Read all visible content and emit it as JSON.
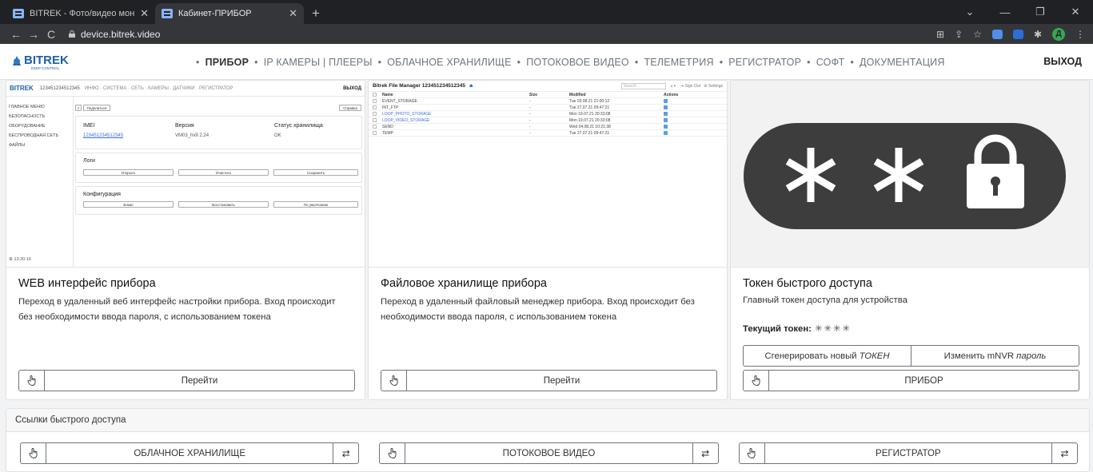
{
  "browser": {
    "tabs": [
      {
        "title": "BITREK - Фото/видео монитори"
      },
      {
        "title": "Кабинет-ПРИБОР"
      }
    ],
    "url": "device.bitrek.video",
    "profile_initial": "Д"
  },
  "header": {
    "logo_text": "BITREK",
    "logo_tagline": "KEEP CONTROL",
    "nav": [
      "ПРИБОР",
      "IP КАМЕРЫ | ПЛЕЕРЫ",
      "ОБЛАЧНОЕ ХРАНИЛИЩЕ",
      "ПОТОКОВОЕ ВИДЕО",
      "ТЕЛЕМЕТРИЯ",
      "РЕГИСТРАТОР",
      "СОФТ",
      "ДОКУМЕНТАЦИЯ"
    ],
    "exit": "ВЫХОД"
  },
  "cards": [
    {
      "title": "WEB интерфейс прибора",
      "text": "Переход в удаленный веб интерфейс настройки прибора. Вход происходит без необходимости ввода пароля, с использованием токена",
      "button": "Перейти"
    },
    {
      "title": "Файловое хранилище прибора",
      "text": "Переход в удаленный файловый менеджер прибора. Вход происходит без необходимости ввода пароля, с использованием токена",
      "button": "Перейти"
    },
    {
      "title": "Токен быстрого доступа",
      "text": "Главный токен доступа для устройства",
      "token_label": "Текущий токен:",
      "token_value": "✳✳✳✳",
      "generate": "Сгенерировать новый",
      "generate_em": "ТОКЕН",
      "change": "Изменить mNVR",
      "change_em": "пароль",
      "button": "ПРИБОР"
    }
  ],
  "quick": {
    "header": "Ссылки быстрого доступа",
    "links": [
      "ОБЛАЧНОЕ ХРАНИЛИЩЕ",
      "ПОТОКОВОЕ ВИДЕО",
      "РЕГИСТРАТОР"
    ]
  },
  "preview_web": {
    "device": "123451234512345",
    "nav": "ИНФО · СИСТЕМА · СЕТЬ · КАМЕРЫ · ДАТЧИКИ · РЕГИСТРАТОР",
    "exit": "ВЫХОД",
    "side": [
      "ГЛАВНОЕ МЕНЮ",
      "БЕЗОПАСНОСТЬ",
      "ОБОРУДОВАНИЕ",
      "БЕСПРОВОДНАЯ СЕТЬ",
      "ФАЙЛЫ"
    ],
    "share": "Поделиться",
    "help": "Справка",
    "imei_label": "IMEI",
    "imei": "123451234512345",
    "ver_label": "Версия",
    "ver": "VM03_hv9 2.24",
    "stat_label": "Статус хранилища",
    "stat": "OK",
    "logs": "Логи",
    "log_btns": [
      "Открыть",
      "Очистить",
      "Сохранить"
    ],
    "conf": "Конфигурация",
    "conf_btns": [
      "Бэкап",
      "Восстановить",
      "По умолчанию"
    ],
    "time": "13:20:16"
  },
  "preview_fm": {
    "title": "Bitrek File Manager 123451234512345",
    "search": "Search",
    "signout": "Sign Out",
    "settings": "Settings",
    "cols": [
      "Name",
      "Size",
      "Modified",
      "Actions"
    ],
    "rows": [
      {
        "name": "EVENT_STORAGE",
        "size": "-",
        "mod": "Tue 03.08.21 21:00:12"
      },
      {
        "name": "INT_FTP",
        "size": "-",
        "mod": "Tue 27.07.21 09:47:21"
      },
      {
        "name": "LOOP_PHOTO_STORAGE",
        "size": "-",
        "mod": "Mon 19.07.21 20:33:08"
      },
      {
        "name": "LOOP_VIDEO_STORAGE",
        "size": "-",
        "mod": "Mon 19.07.21 20:33:08"
      },
      {
        "name": "SEND",
        "size": "-",
        "mod": "Wed 04.08.21 10:21:38"
      },
      {
        "name": "TEMP",
        "size": "-",
        "mod": "Tue 27.07.21 09:47:21"
      }
    ]
  }
}
